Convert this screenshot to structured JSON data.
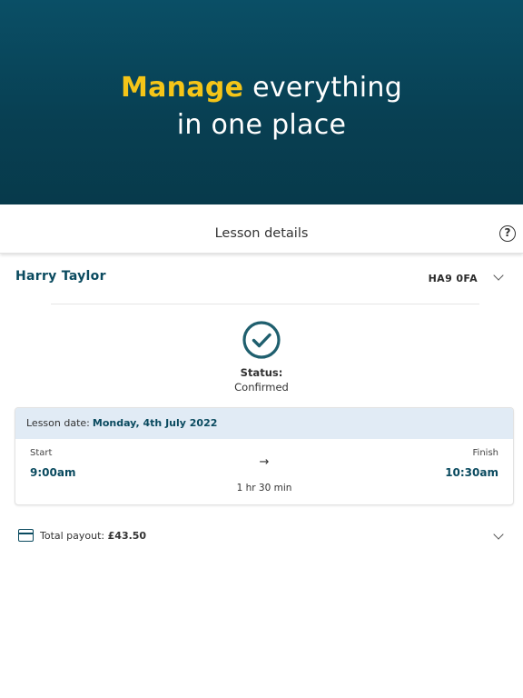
{
  "hero": {
    "accent_word": "Manage",
    "line1_rest": " everything",
    "line2": "in one place",
    "accent_color": "#f5c518",
    "background_color": "#0a4f66"
  },
  "header": {
    "title": "Lesson details",
    "help_icon": "question-circle-icon",
    "help_glyph": "?"
  },
  "student": {
    "name": "Harry Taylor",
    "postcode": "HA9 0FA",
    "expand_icon": "chevron-down-icon"
  },
  "status": {
    "icon": "check-circle-icon",
    "label": "Status:",
    "value": "Confirmed",
    "color": "#1f5f6e"
  },
  "lesson": {
    "date_label": "Lesson date:",
    "date_value": "Monday, 4th July 2022",
    "start_label": "Start",
    "start_time": "9:00am",
    "finish_label": "Finish",
    "finish_time": "10:30am",
    "arrow": "→",
    "duration": "1 hr 30 min"
  },
  "payout": {
    "icon": "credit-card-icon",
    "label": "Total payout:",
    "amount": "£43.50",
    "expand_icon": "chevron-down-icon"
  }
}
